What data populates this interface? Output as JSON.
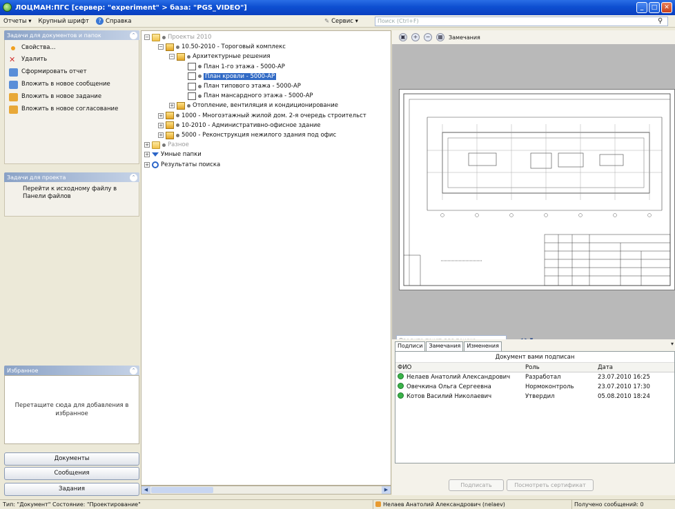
{
  "app": {
    "title": "ЛОЦМАН:ПГС  [сервер: \"experiment\" > база: \"PGS_VIDEO\"]"
  },
  "menu": {
    "reports": "Отчеты ▾",
    "bigfont": "Крупный шрифт",
    "help": "Справка",
    "service": "Сервис ▾",
    "search_placeholder": "Поиск (Ctrl+F)"
  },
  "left": {
    "doc_tasks_title": "Задачи для документов и папок",
    "doc_tasks": [
      {
        "label": "Свойства...",
        "icon": "properties-icon",
        "color": "#f0a020"
      },
      {
        "label": "Удалить",
        "icon": "delete-icon",
        "color": "#d03030"
      },
      {
        "label": "Сформировать отчет",
        "icon": "report-icon",
        "color": "#5a8ed8"
      },
      {
        "label": "Вложить в новое сообщение",
        "icon": "message-icon",
        "color": "#5a8ed8"
      },
      {
        "label": "Вложить в новое задание",
        "icon": "task-icon",
        "color": "#e8a838"
      },
      {
        "label": "Вложить в новое согласование",
        "icon": "approval-icon",
        "color": "#e8a838"
      }
    ],
    "project_tasks_title": "Задачи для проекта",
    "project_task": "Перейти к исходному файлу в Панели файлов",
    "fav_title": "Избранное",
    "fav_hint": "Перетащите сюда для добавления в избранное",
    "nav": [
      "Документы",
      "Сообщения",
      "Задания"
    ]
  },
  "tree": [
    {
      "label": "Проекты 2010",
      "level": 0,
      "exp": "⊟",
      "icon": "folder",
      "grey": true
    },
    {
      "label": "10.50-2010 - Тороговый комплекс",
      "level": 1,
      "exp": "⊟",
      "icon": "bld"
    },
    {
      "label": "Архитектурные решения",
      "level": 2,
      "exp": "⊟",
      "icon": "bld"
    },
    {
      "label": "План 1-го этажа - 5000-АР",
      "level": 3,
      "icon": "doc"
    },
    {
      "label": "План кровли - 5000-АР",
      "level": 3,
      "icon": "doc",
      "selected": true
    },
    {
      "label": "План типового этажа - 5000-АР",
      "level": 3,
      "icon": "doc"
    },
    {
      "label": "План мансардного этажа - 5000-АР",
      "level": 3,
      "icon": "doc"
    },
    {
      "label": "Отопление, вентиляция и кондиционирование",
      "level": 2,
      "exp": "⊞",
      "icon": "bld"
    },
    {
      "label": "1000 - Многоэтажный жилой дом. 2-я очередь строительст",
      "level": 1,
      "exp": "⊞",
      "icon": "bld"
    },
    {
      "label": "10-2010 - Административно-офисное здание",
      "level": 1,
      "exp": "⊞",
      "icon": "bld"
    },
    {
      "label": "5000 - Реконструкция нежилого здания под офис",
      "level": 1,
      "exp": "⊞",
      "icon": "bld"
    },
    {
      "label": "Разное",
      "level": 0,
      "exp": "⊞",
      "icon": "folder",
      "grey": true
    },
    {
      "label": "Умные папки",
      "level": 0,
      "exp": "⊞",
      "icon": "filter"
    },
    {
      "label": "Результаты поиска",
      "level": 0,
      "exp": "⊞",
      "icon": "search"
    }
  ],
  "viewer": {
    "notes": "Замечания",
    "search_placeholder": "Введите текст для поиска..."
  },
  "signatures": {
    "tabs": [
      "Подписи",
      "Замечания",
      "Изменения"
    ],
    "caption": "Документ вами подписан",
    "headers": [
      "ФИО",
      "Роль",
      "Дата"
    ],
    "rows": [
      [
        "Нелаев Анатолий Александрович",
        "Разработал",
        "23.07.2010 16:25"
      ],
      [
        "Овечкина Ольга Сергеевна",
        "Нормоконтроль",
        "23.07.2010 17:30"
      ],
      [
        "Котов Василий Николаевич",
        "Утвердил",
        "05.08.2010 18:24"
      ]
    ],
    "sign_btn": "Подписать",
    "cert_btn": "Посмотреть сертификат"
  },
  "status": {
    "type": "Тип: \"Документ\"  Состояние: \"Проектирование\"",
    "user": "Нелаев Анатолий Александрович (nelaev)",
    "messages": "Получено сообщений: 0"
  }
}
